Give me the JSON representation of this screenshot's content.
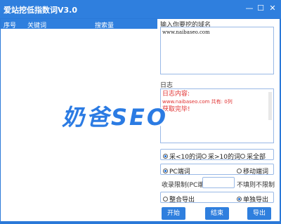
{
  "window": {
    "title": "爱站挖低指数词V3.0",
    "min_label": "—",
    "max_label": "☐",
    "close_label": "✕"
  },
  "table": {
    "headers": [
      "序号",
      "关键词",
      "搜索量"
    ]
  },
  "domain_input": {
    "label": "输入你要挖的域名",
    "value": "www.naibaseo.com"
  },
  "log": {
    "label": "日志",
    "line1": "日志内容:",
    "line2": "www.naibaseo.com 共有: 0列",
    "line3": "获取完毕!"
  },
  "filters": {
    "range_options": [
      "采<10的词",
      "采>10的词",
      "采全部"
    ],
    "device_options": [
      "PC端词",
      "移动端词"
    ],
    "limit_label": "收录限制(PC端)",
    "limit_value": "",
    "limit_hint": "不填则不限制",
    "export_options": [
      "整合导出",
      "单独导出"
    ]
  },
  "buttons": {
    "start": "开始",
    "end": "结束",
    "export": "导出"
  },
  "watermark": {
    "text": "奶爸SEO"
  },
  "colors": {
    "accent": "#2f7fde",
    "log_text": "#e03030"
  }
}
